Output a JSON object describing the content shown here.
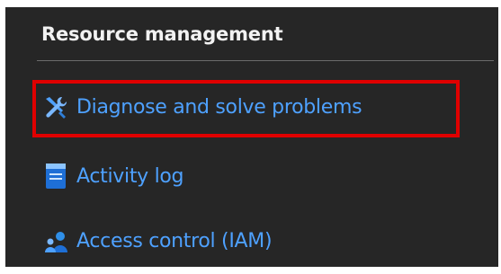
{
  "section": {
    "title": "Resource management"
  },
  "menu": {
    "items": [
      {
        "label": "Diagnose and solve problems",
        "icon": "wrench-screwdriver-icon",
        "highlighted": true
      },
      {
        "label": "Activity log",
        "icon": "activity-log-icon",
        "highlighted": false
      },
      {
        "label": "Access control (IAM)",
        "icon": "users-iam-icon",
        "highlighted": false
      }
    ]
  },
  "colors": {
    "panel_background": "#262626",
    "link_text": "#4ea1ff",
    "header_text": "#f2f2f2",
    "highlight_border": "#e00000"
  }
}
